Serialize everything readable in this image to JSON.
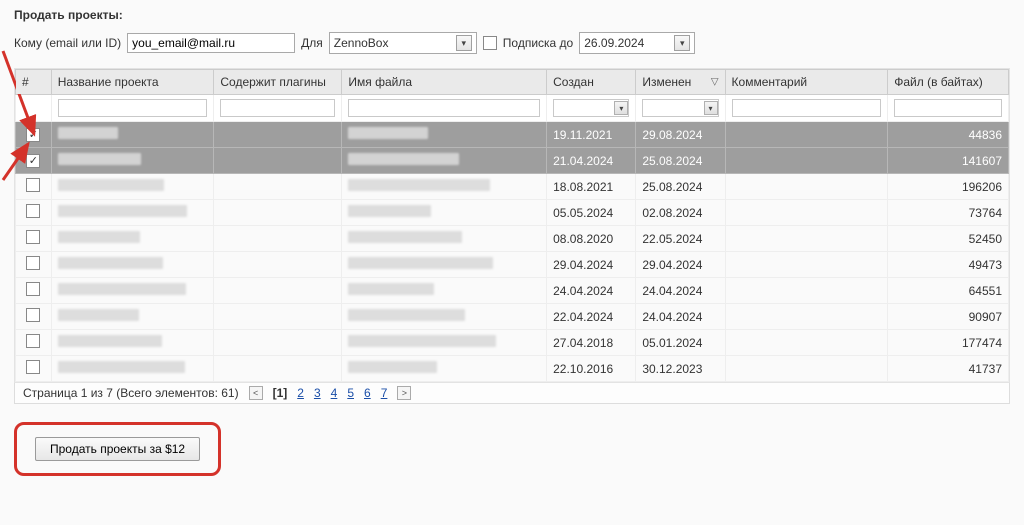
{
  "header": {
    "title": "Продать проекты:"
  },
  "form": {
    "to_label": "Кому (email или ID)",
    "to_value": "you_email@mail.ru",
    "for_label": "Для",
    "for_value": "ZennoBox",
    "sub_label": "Подписка до",
    "sub_value": "26.09.2024"
  },
  "columns": {
    "chk": "#",
    "name": "Название проекта",
    "plugins": "Содержит плагины",
    "file": "Имя файла",
    "created": "Создан",
    "modified": "Изменен",
    "comment": "Комментарий",
    "size": "Файл (в байтах)"
  },
  "rows": [
    {
      "checked": true,
      "selected": true,
      "created": "19.11.2021",
      "modified": "29.08.2024",
      "size": "44836"
    },
    {
      "checked": true,
      "selected": true,
      "created": "21.04.2024",
      "modified": "25.08.2024",
      "size": "141607"
    },
    {
      "checked": false,
      "selected": false,
      "created": "18.08.2021",
      "modified": "25.08.2024",
      "size": "196206"
    },
    {
      "checked": false,
      "selected": false,
      "created": "05.05.2024",
      "modified": "02.08.2024",
      "size": "73764"
    },
    {
      "checked": false,
      "selected": false,
      "created": "08.08.2020",
      "modified": "22.05.2024",
      "size": "52450"
    },
    {
      "checked": false,
      "selected": false,
      "created": "29.04.2024",
      "modified": "29.04.2024",
      "size": "49473"
    },
    {
      "checked": false,
      "selected": false,
      "created": "24.04.2024",
      "modified": "24.04.2024",
      "size": "64551"
    },
    {
      "checked": false,
      "selected": false,
      "created": "22.04.2024",
      "modified": "24.04.2024",
      "size": "90907"
    },
    {
      "checked": false,
      "selected": false,
      "created": "27.04.2018",
      "modified": "05.01.2024",
      "size": "177474"
    },
    {
      "checked": false,
      "selected": false,
      "created": "22.10.2016",
      "modified": "30.12.2023",
      "size": "41737"
    }
  ],
  "pager": {
    "summary": "Страница 1 из 7 (Всего элементов: 61)",
    "current": "[1]",
    "pages": [
      "2",
      "3",
      "4",
      "5",
      "6",
      "7"
    ]
  },
  "action": {
    "sell_label": "Продать проекты за $12"
  }
}
